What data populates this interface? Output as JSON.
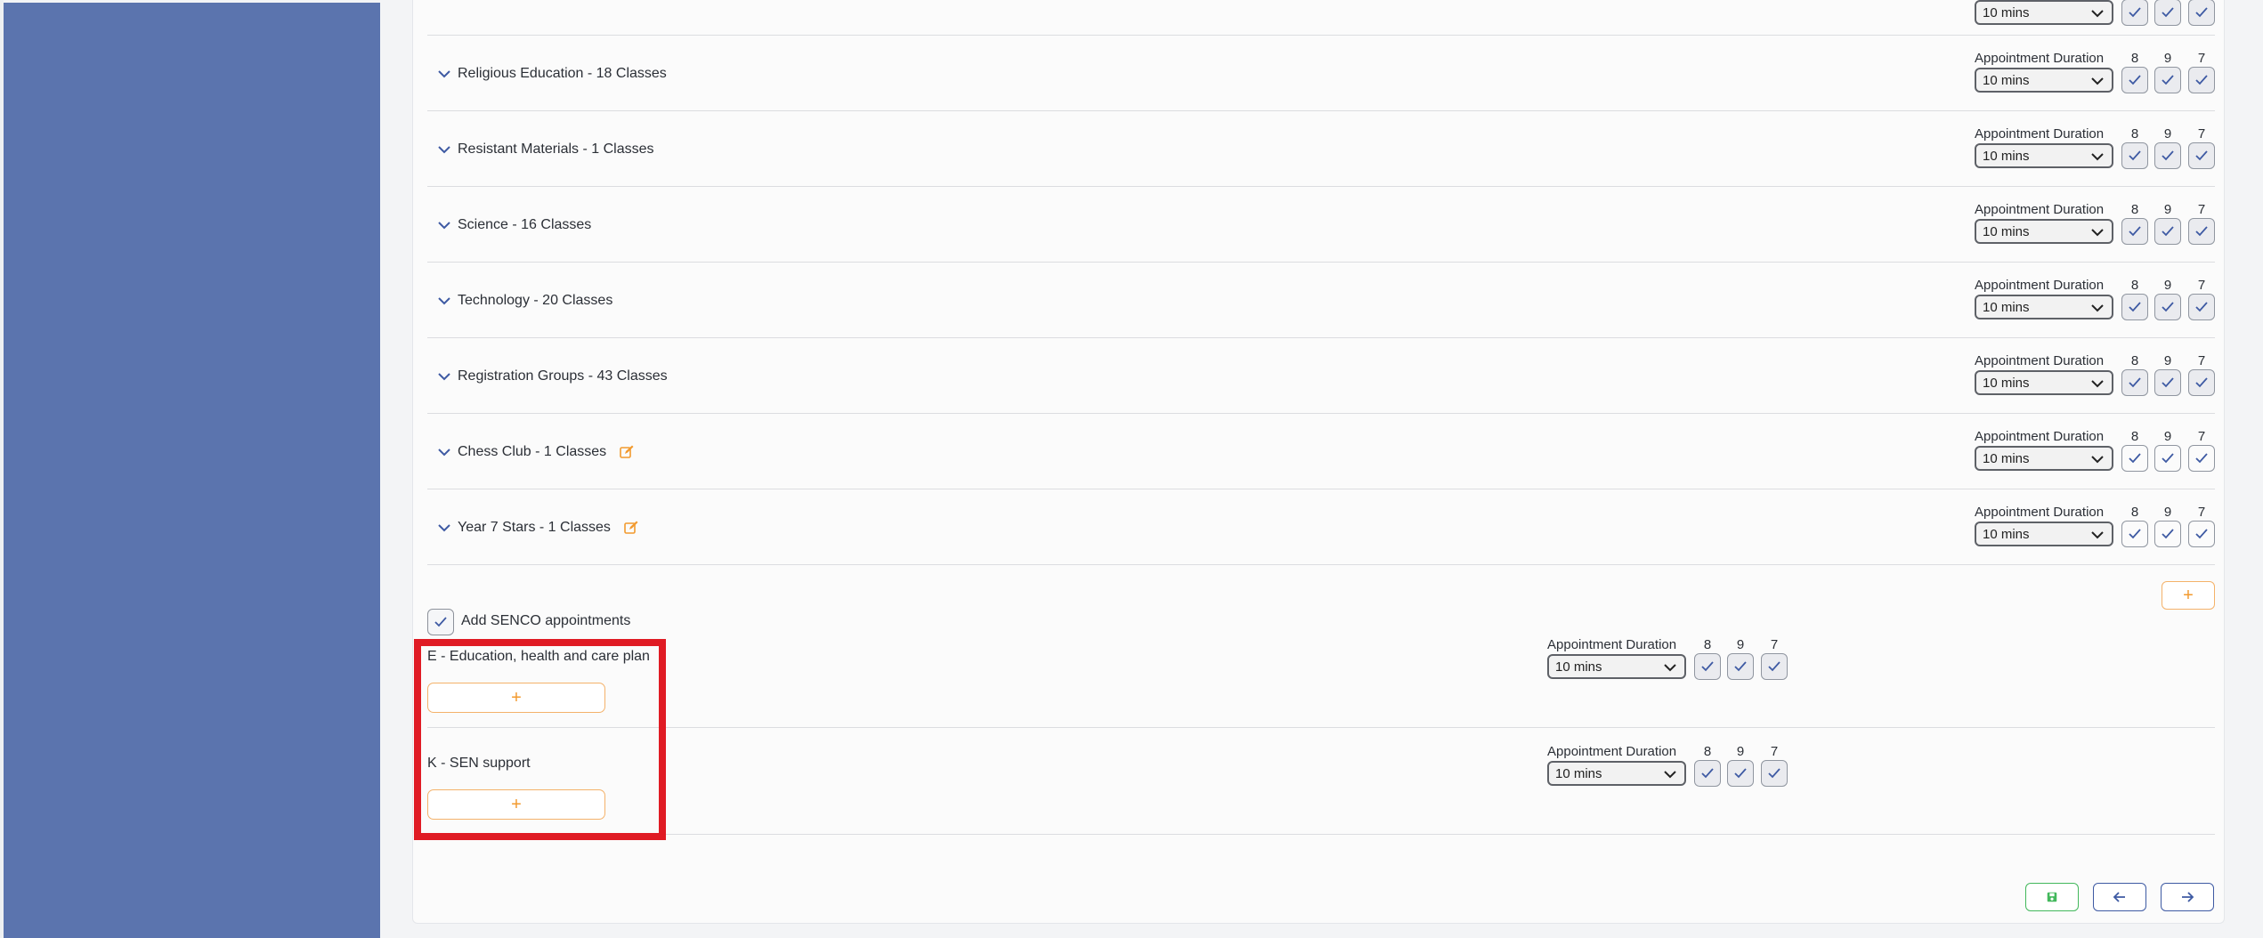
{
  "subjects": [
    {
      "label": "Religious Education - 18 Classes",
      "editable": false
    },
    {
      "label": "Resistant Materials - 1 Classes",
      "editable": false
    },
    {
      "label": "Science - 16 Classes",
      "editable": false
    },
    {
      "label": "Technology - 20 Classes",
      "editable": false
    },
    {
      "label": "Registration Groups - 43 Classes",
      "editable": false
    },
    {
      "label": "Chess Club - 1 Classes",
      "editable": true
    },
    {
      "label": "Year 7 Stars - 1 Classes",
      "editable": true
    }
  ],
  "duration": {
    "label": "Appointment Duration",
    "value": "10 mins"
  },
  "year_groups": [
    "8",
    "9",
    "7"
  ],
  "senco": {
    "label": "Add SENCO appointments",
    "checked": true,
    "groups": [
      {
        "label": "E - Education, health and care plan"
      },
      {
        "label": "K - SEN support"
      }
    ],
    "add_symbol": "+"
  },
  "add_symbol": "+",
  "icons": {
    "expand": "chevron-down-icon",
    "edit": "edit-icon",
    "check": "check-icon",
    "save": "save-icon",
    "back": "arrow-left-icon",
    "next": "arrow-right-icon"
  },
  "colors": {
    "sidebar": "#5b74ae",
    "accent_blue": "#3e5aa3",
    "orange": "#f29a2e",
    "save_green": "#43b85c",
    "highlight_red": "#e01b24"
  }
}
